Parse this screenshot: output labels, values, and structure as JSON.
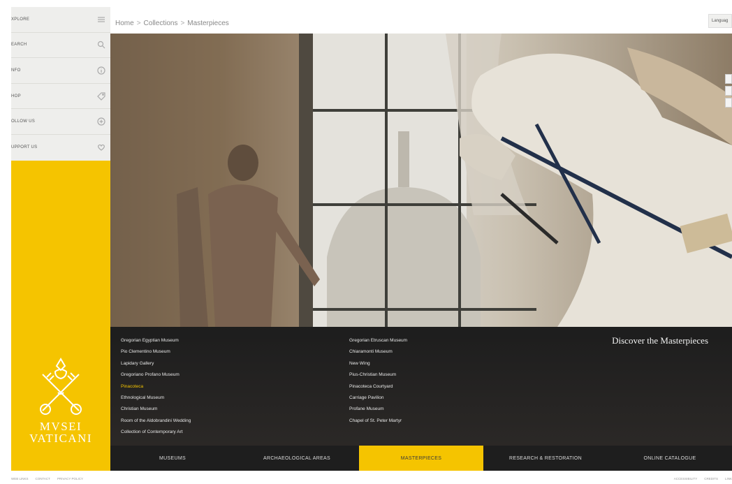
{
  "sidebar": {
    "items": [
      {
        "label": "XPLORE",
        "icon": "menu-lines-icon"
      },
      {
        "label": "EARCH",
        "icon": "search-icon"
      },
      {
        "label": "NFO",
        "icon": "info-icon"
      },
      {
        "label": "HOP",
        "icon": "tag-icon"
      },
      {
        "label": "OLLOW US",
        "icon": "plus-circle-icon"
      },
      {
        "label": "UPPORT US",
        "icon": "heart-icon"
      }
    ],
    "logo_line1": "MVSEI",
    "logo_line2": "VATICANI",
    "accent_color": "#f5c400"
  },
  "header": {
    "breadcrumb": [
      "Home",
      "Collections",
      "Masterpieces"
    ],
    "separator": ">",
    "language_label": "Languag"
  },
  "panel": {
    "title": "Discover the Masterpieces",
    "col1": [
      {
        "label": "Gregorian Egyptian Museum",
        "active": false
      },
      {
        "label": "Pio Clementino Museum",
        "active": false
      },
      {
        "label": "Lapidary Gallery",
        "active": false
      },
      {
        "label": "Gregoriano Profano Museum",
        "active": false
      },
      {
        "label": "Pinacoteca",
        "active": true
      },
      {
        "label": "Ethnological Museum",
        "active": false
      },
      {
        "label": "Christian Museum",
        "active": false
      },
      {
        "label": "Room of the Aldobrandini Wedding",
        "active": false
      },
      {
        "label": "Collection of Contemporary Art",
        "active": false
      }
    ],
    "col2": [
      {
        "label": "Gregorian Etruscan Museum",
        "active": false
      },
      {
        "label": "Chiaramonti Museum",
        "active": false
      },
      {
        "label": "New Wing",
        "active": false
      },
      {
        "label": "Pius-Christian Museum",
        "active": false
      },
      {
        "label": "Pinacoteca Courtyard",
        "active": false
      },
      {
        "label": "Carriage Pavilion",
        "active": false
      },
      {
        "label": "Profane Museum",
        "active": false
      },
      {
        "label": "Chapel of St. Peter Martyr",
        "active": false
      }
    ]
  },
  "nav": {
    "tabs": [
      {
        "label": "MUSEUMS",
        "active": false
      },
      {
        "label": "ARCHAEOLOGICAL AREAS",
        "active": false
      },
      {
        "label": "MASTERPIECES",
        "active": true
      },
      {
        "label": "RESEARCH & RESTORATION",
        "active": false
      },
      {
        "label": "ONLINE CATALOGUE",
        "active": false
      }
    ]
  },
  "footer": {
    "left": [
      "WEB LINKS",
      "CONTACT",
      "PRIVACY POLICY"
    ],
    "right": [
      "ACCESSIBILITY",
      "CREDITS",
      "LINK"
    ]
  }
}
